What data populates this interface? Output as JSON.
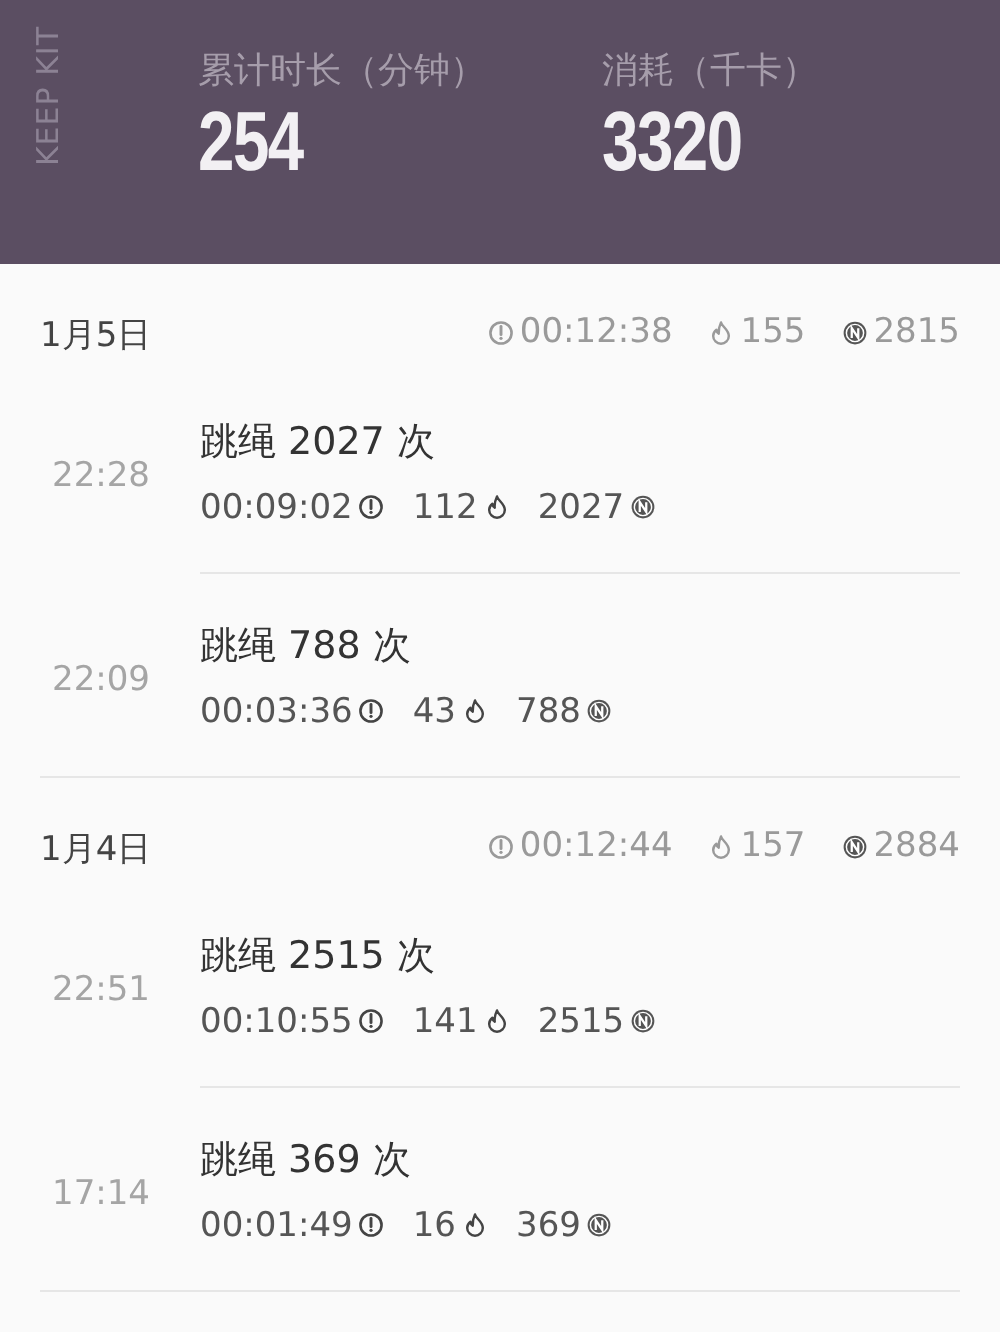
{
  "summary": {
    "brand": "KEEP KIT",
    "stats": [
      {
        "label": "累计时长（分钟）",
        "value": "254"
      },
      {
        "label": "消耗（千卡）",
        "value": "3320"
      }
    ]
  },
  "days": [
    {
      "date": "1月5日",
      "duration": "00:12:38",
      "calories": "155",
      "count": "2815",
      "sessions": [
        {
          "time": "22:28",
          "title": "跳绳 2027 次",
          "duration": "00:09:02",
          "calories": "112",
          "count": "2027"
        },
        {
          "time": "22:09",
          "title": "跳绳 788 次",
          "duration": "00:03:36",
          "calories": "43",
          "count": "788"
        }
      ]
    },
    {
      "date": "1月4日",
      "duration": "00:12:44",
      "calories": "157",
      "count": "2884",
      "sessions": [
        {
          "time": "22:51",
          "title": "跳绳 2515 次",
          "duration": "00:10:55",
          "calories": "141",
          "count": "2515"
        },
        {
          "time": "17:14",
          "title": "跳绳 369 次",
          "duration": "00:01:49",
          "calories": "16",
          "count": "369"
        }
      ]
    }
  ]
}
